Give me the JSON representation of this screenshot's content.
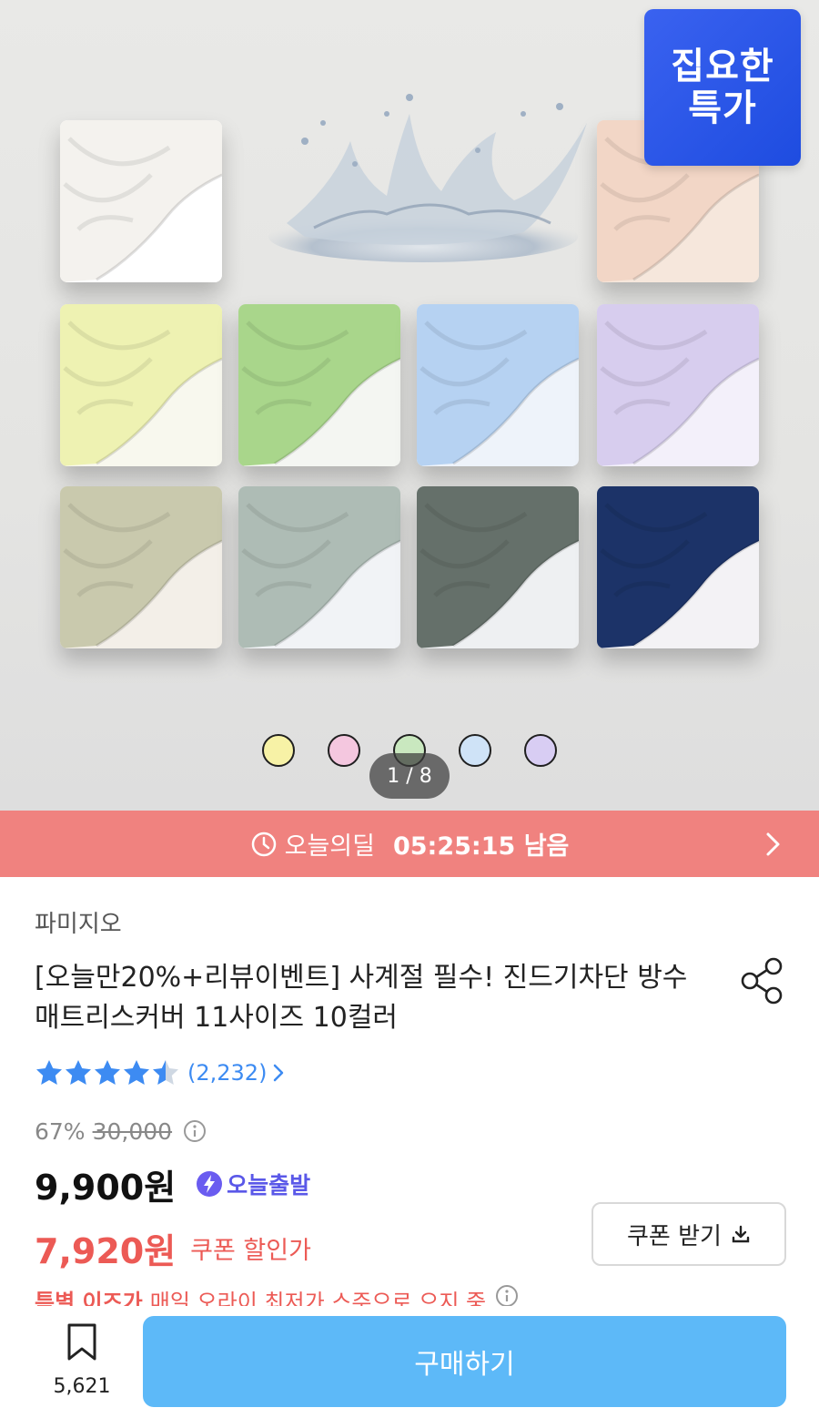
{
  "hero": {
    "deal_tag_line1": "집요한",
    "deal_tag_line2": "특가",
    "page_indicator": "1 / 8",
    "swatch_dots": [
      "#f7f2a6",
      "#f4c7df",
      "#c9e8bf",
      "#cfe3f7",
      "#d8cdf3"
    ],
    "sheet_colors": [
      {
        "top": "#f4f2ee",
        "bottom": "#ffffff"
      },
      {
        "top": "#f2d6c6",
        "bottom": "#f6e7dc"
      },
      {
        "top": "#eef2b2",
        "bottom": "#f8f8ee"
      },
      {
        "top": "#a9d68b",
        "bottom": "#f4f6f2"
      },
      {
        "top": "#b6d2f2",
        "bottom": "#eef3fa"
      },
      {
        "top": "#d7cdee",
        "bottom": "#f3f0fa"
      },
      {
        "top": "#c9c9ad",
        "bottom": "#f3efe8"
      },
      {
        "top": "#aebcb5",
        "bottom": "#f1f3f6"
      },
      {
        "top": "#65706a",
        "bottom": "#eef0f2"
      },
      {
        "top": "#1c3368",
        "bottom": "#f3f2f5"
      }
    ]
  },
  "deal_bar": {
    "label": "오늘의딜",
    "countdown": "05:25:15 남음",
    "background": "#f0827f"
  },
  "product": {
    "brand": "파미지오",
    "title": "[오늘만20%+리뷰이벤트] 사계절 필수! 진드기차단 방수 매트리스커버 11사이즈 10컬러",
    "rating": 4.5,
    "review_count": "(2,232)",
    "discount_percent": "67%",
    "original_price": "30,000",
    "price": "9,900원",
    "delivery_badge": "오늘출발",
    "coupon_price": "7,920원",
    "coupon_label": "쿠폰 할인가",
    "coupon_button": "쿠폰 받기",
    "special_label": "특별 이즈가",
    "special_text": "매일 오라이 최저가 스주으로 으지 중"
  },
  "bottom_bar": {
    "bookmark_count": "5,621",
    "buy_button": "구매하기"
  },
  "colors": {
    "accent_blue": "#5db9f8",
    "coupon_red": "#ec5a55",
    "star_blue": "#3d8bf2",
    "deal_tag_blue": "#2a55e8"
  }
}
